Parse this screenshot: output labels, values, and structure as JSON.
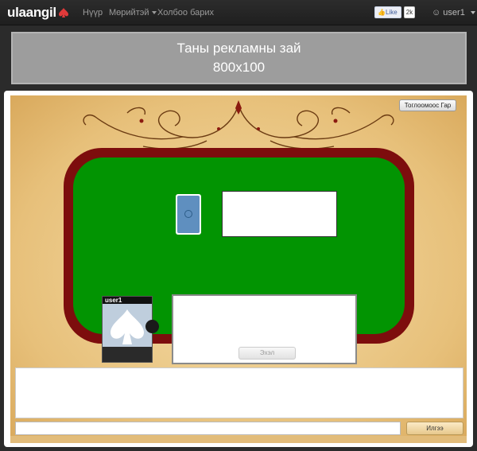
{
  "navbar": {
    "brand": "ulaangil",
    "links": [
      {
        "label": "Нүүр"
      },
      {
        "label": "Мөрийтэй",
        "has_caret": true
      },
      {
        "label": "Холбоо барих"
      }
    ],
    "like_label": "Like",
    "like_count": "2k",
    "user_label": "user1"
  },
  "ad": {
    "line1": "Таны рекламны зай",
    "line2": "800x100"
  },
  "game": {
    "top_button_label": "Тоглоомоос Гар",
    "player_name": "user1",
    "play_button_label": "Эхэл"
  },
  "chat": {
    "input_value": "",
    "send_label": "Илгээ"
  },
  "colors": {
    "rail": "#7d0d0d",
    "felt": "#029402",
    "brand_spade": "#e03a3a"
  }
}
